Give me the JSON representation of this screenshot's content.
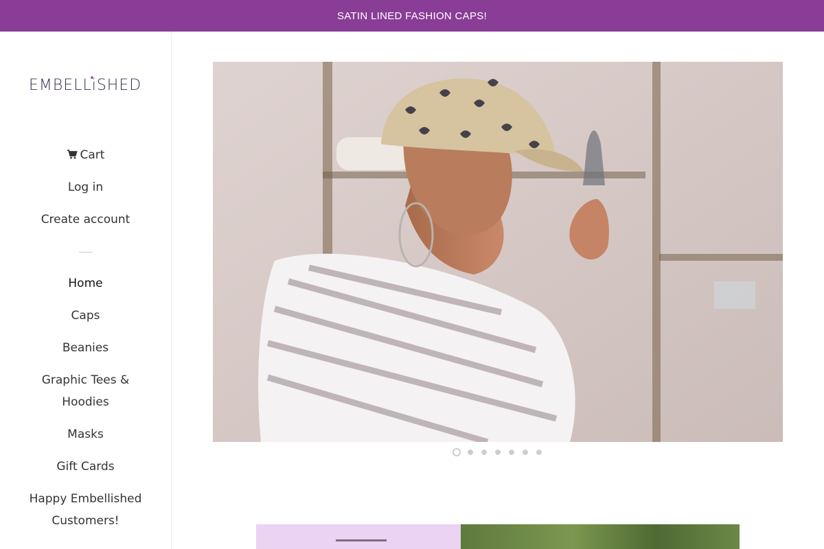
{
  "announcement": {
    "text": "SATIN LINED FASHION CAPS!"
  },
  "brand": {
    "logo_text": "EMBELLiSHED"
  },
  "account": {
    "cart_label": "Cart",
    "login_label": "Log in",
    "create_account_label": "Create account"
  },
  "nav": {
    "items": [
      {
        "label": "Home"
      },
      {
        "label": "Caps"
      },
      {
        "label": "Beanies"
      },
      {
        "label": "Graphic Tees &",
        "label2": "Hoodies"
      },
      {
        "label": "Masks"
      },
      {
        "label": "Gift Cards"
      },
      {
        "label": "Happy Embellished",
        "label2": "Customers!"
      }
    ]
  },
  "slideshow": {
    "slide_count": 7,
    "active_index": 0
  },
  "colors": {
    "accent": "#8a3d96",
    "feature_pink": "#ebd3f3"
  }
}
